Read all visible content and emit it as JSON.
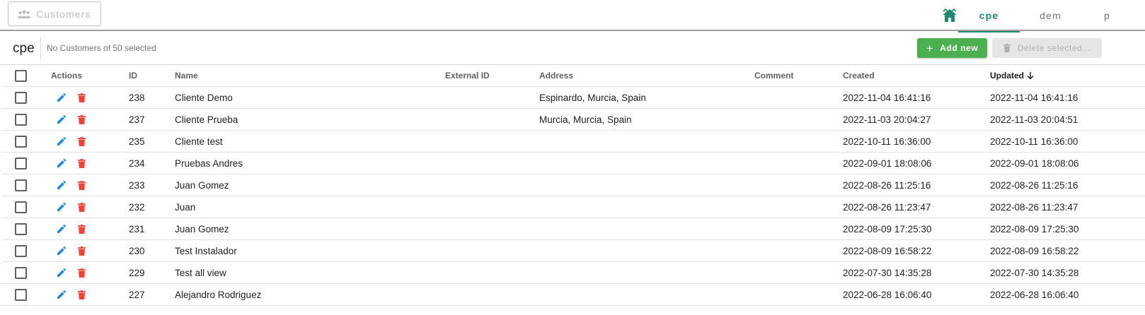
{
  "topbar": {
    "customers_button": "Customers",
    "tabs": [
      {
        "label": "cpe",
        "active": true
      },
      {
        "label": "dem",
        "active": false
      },
      {
        "label": "p",
        "active": false
      }
    ]
  },
  "toolbar": {
    "title": "cpe",
    "selection_info": "No Customers of 50 selected",
    "add_label": "Add new",
    "delete_label": "Delete selected..."
  },
  "table": {
    "columns": {
      "actions": "Actions",
      "id": "ID",
      "name": "Name",
      "external_id": "External ID",
      "address": "Address",
      "comment": "Comment",
      "created": "Created",
      "updated": "Updated"
    },
    "rows": [
      {
        "id": "238",
        "name": "Cliente Demo",
        "external_id": "",
        "address": "Espinardo, Murcia, Spain",
        "comment": "",
        "created": "2022-11-04 16:41:16",
        "updated": "2022-11-04 16:41:16"
      },
      {
        "id": "237",
        "name": "Cliente Prueba",
        "external_id": "",
        "address": "Murcia, Murcia, Spain",
        "comment": "",
        "created": "2022-11-03 20:04:27",
        "updated": "2022-11-03 20:04:51"
      },
      {
        "id": "235",
        "name": "Cliente test",
        "external_id": "",
        "address": "",
        "comment": "",
        "created": "2022-10-11 16:36:00",
        "updated": "2022-10-11 16:36:00"
      },
      {
        "id": "234",
        "name": "Pruebas Andres",
        "external_id": "",
        "address": "",
        "comment": "",
        "created": "2022-09-01 18:08:06",
        "updated": "2022-09-01 18:08:06"
      },
      {
        "id": "233",
        "name": "Juan Gomez",
        "external_id": "",
        "address": "",
        "comment": "",
        "created": "2022-08-26 11:25:16",
        "updated": "2022-08-26 11:25:16"
      },
      {
        "id": "232",
        "name": "Juan",
        "external_id": "",
        "address": "",
        "comment": "",
        "created": "2022-08-26 11:23:47",
        "updated": "2022-08-26 11:23:47"
      },
      {
        "id": "231",
        "name": "Juan Gomez",
        "external_id": "",
        "address": "",
        "comment": "",
        "created": "2022-08-09 17:25:30",
        "updated": "2022-08-09 17:25:30"
      },
      {
        "id": "230",
        "name": "Test Instalador",
        "external_id": "",
        "address": "",
        "comment": "",
        "created": "2022-08-09 16:58:22",
        "updated": "2022-08-09 16:58:22"
      },
      {
        "id": "229",
        "name": "Test all view",
        "external_id": "",
        "address": "",
        "comment": "",
        "created": "2022-07-30 14:35:28",
        "updated": "2022-07-30 14:35:28"
      },
      {
        "id": "227",
        "name": "Alejandro Rodriguez",
        "external_id": "",
        "address": "",
        "comment": "",
        "created": "2022-06-28 16:06:40",
        "updated": "2022-06-28 16:06:40"
      }
    ]
  },
  "colors": {
    "accent": "#1f8a70",
    "add_button": "#4caf50",
    "edit_icon": "#1e88e5",
    "delete_icon": "#f44336"
  },
  "icons": [
    "people-icon",
    "home-network-icon",
    "plus-icon",
    "trash-icon",
    "pencil-icon",
    "arrow-down-icon"
  ]
}
